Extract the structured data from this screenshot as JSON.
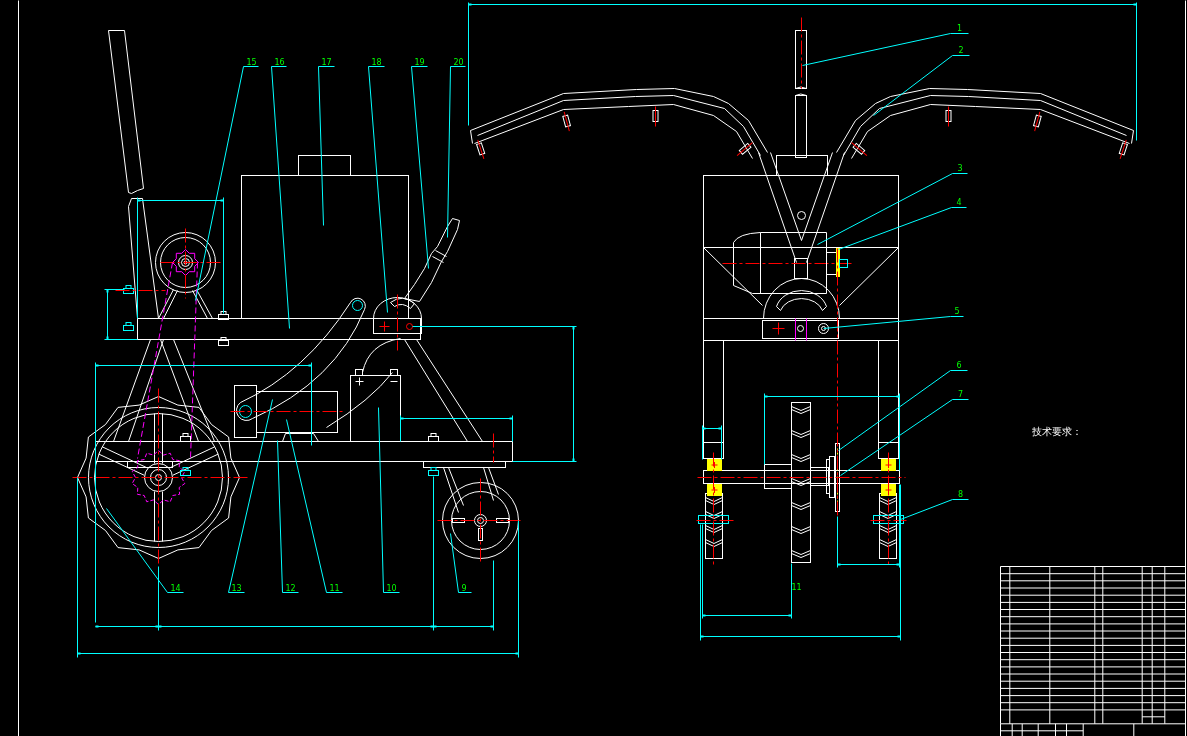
{
  "side_view": {
    "callouts": [
      "15",
      "16",
      "17",
      "18",
      "19",
      "20",
      "14",
      "13",
      "12",
      "11",
      "10",
      "9"
    ]
  },
  "front_view": {
    "callouts": [
      "1",
      "2",
      "3",
      "4",
      "5",
      "6",
      "7",
      "8",
      "11"
    ]
  },
  "technical_notes": {
    "heading": "技术要求："
  }
}
